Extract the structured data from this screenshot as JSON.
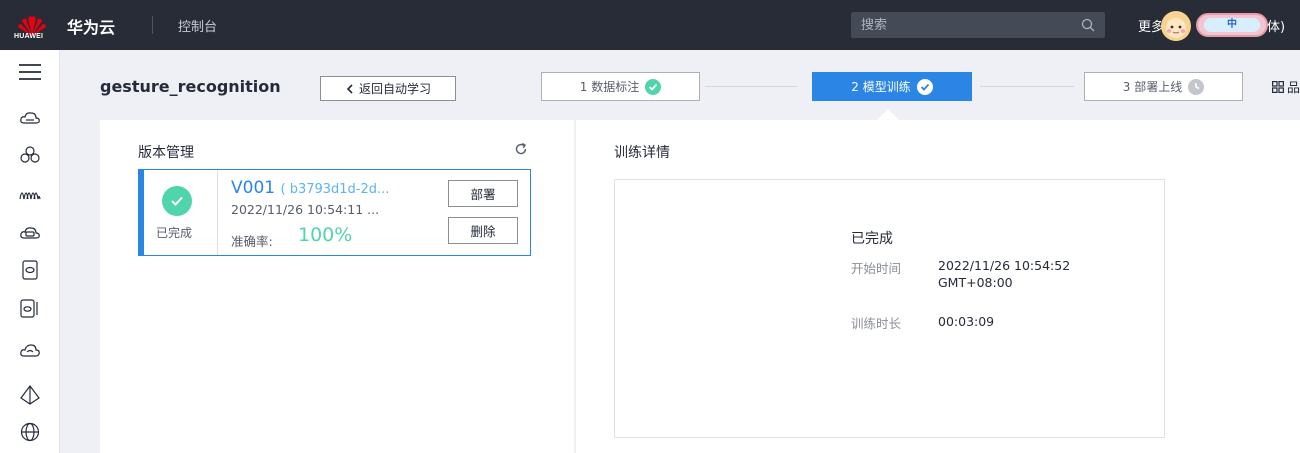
{
  "topbar": {
    "logo_text": "HUAWEI",
    "brand": "华为云",
    "console": "控制台",
    "search_placeholder": "搜索",
    "more": "更多",
    "lang_badge": "中",
    "lang_tail": "体)"
  },
  "rail": {
    "items": [
      "menu-icon",
      "cloud-stack-icon",
      "clover-icon",
      "waves-icon",
      "server-cloud-icon",
      "tablet-icon",
      "tablets-icon",
      "cloud-outline-icon",
      "pyramid-icon",
      "globe-icon"
    ]
  },
  "header": {
    "project_title": "gesture_recognition",
    "back_label": "返回自动学习",
    "steps": [
      {
        "label": "1 数据标注",
        "state": "done"
      },
      {
        "label": "2 模型训练",
        "state": "active"
      },
      {
        "label": "3 部署上线",
        "state": "pending"
      }
    ],
    "more_label": "品"
  },
  "version_panel": {
    "title": "版本管理",
    "card": {
      "status": "已完成",
      "version": "V001",
      "id": "( b3793d1d-2d...",
      "date": "2022/11/26 10:54:11 ...",
      "accuracy_label": "准确率:",
      "accuracy_value": "100%",
      "deploy_label": "部署",
      "delete_label": "删除"
    }
  },
  "detail_panel": {
    "title": "训练详情",
    "status": "已完成",
    "start_label": "开始时间",
    "start_value_line1": "2022/11/26 10:54:52",
    "start_value_line2": "GMT+08:00",
    "duration_label": "训练时长",
    "duration_value": "00:03:09"
  },
  "colors": {
    "topbar": "#272c36",
    "accent": "#2b85e4",
    "success": "#50d4ab"
  }
}
